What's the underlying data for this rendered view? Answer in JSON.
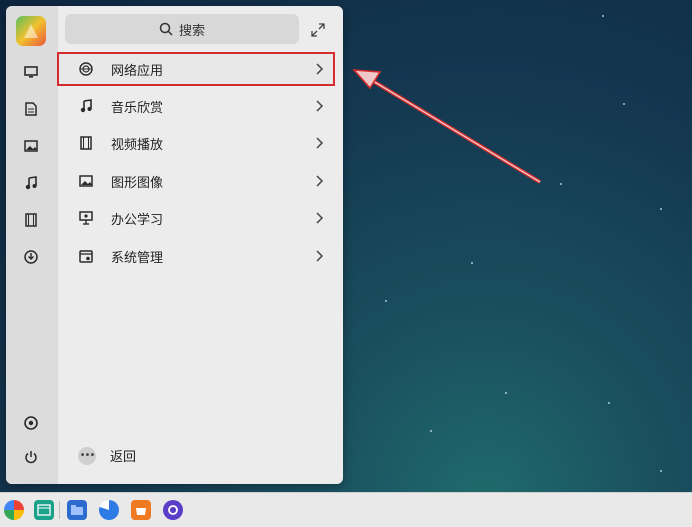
{
  "search": {
    "label": "搜索"
  },
  "menu": {
    "categories": [
      {
        "label": "网络应用",
        "icon": "network-icon",
        "selected": true
      },
      {
        "label": "音乐欣赏",
        "icon": "music-icon"
      },
      {
        "label": "视频播放",
        "icon": "video-icon"
      },
      {
        "label": "图形图像",
        "icon": "image-icon"
      },
      {
        "label": "办公学习",
        "icon": "office-icon"
      },
      {
        "label": "系统管理",
        "icon": "system-icon"
      }
    ],
    "back_label": "返回"
  },
  "sidebar": {
    "items": [
      "computer-icon",
      "document-icon",
      "picture-icon",
      "music-icon",
      "video-icon",
      "download-icon",
      "settings-icon",
      "power-icon"
    ]
  },
  "taskbar": {
    "items": [
      "start-icon",
      "desktop-icon",
      "file-manager-icon",
      "browser-icon",
      "app-store-icon",
      "settings-app-icon"
    ]
  },
  "colors": {
    "highlight": "#d42c2c",
    "arrow": "#d42c2c"
  }
}
